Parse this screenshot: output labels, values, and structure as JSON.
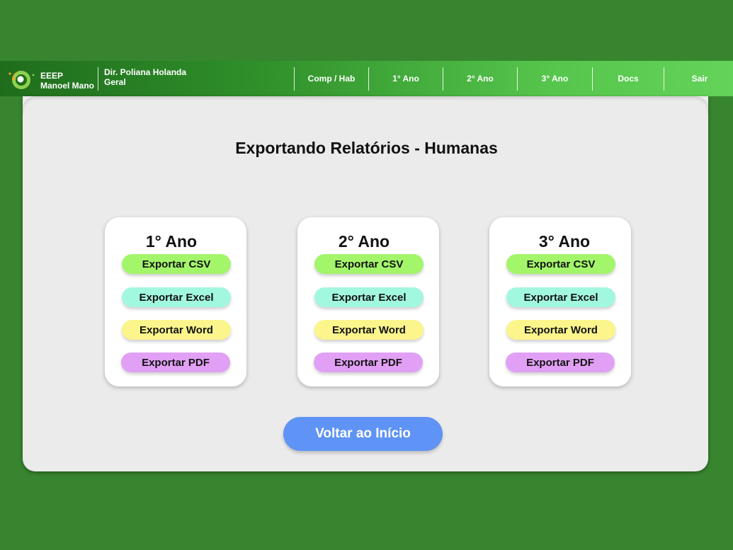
{
  "header": {
    "school_name": "EEEP Manoel Mano",
    "director": "Dir. Poliana Holanda Geral",
    "nav": [
      "Comp / Hab",
      "1° Ano",
      "2° Ano",
      "3° Ano",
      "Docs",
      "Sair"
    ]
  },
  "main": {
    "title": "Exportando Relatórios - Humanas",
    "years": [
      {
        "title": "1° Ano",
        "buttons": [
          "Exportar CSV",
          "Exportar Excel",
          "Exportar Word",
          "Exportar PDF"
        ]
      },
      {
        "title": "2° Ano",
        "buttons": [
          "Exportar CSV",
          "Exportar Excel",
          "Exportar Word",
          "Exportar PDF"
        ]
      },
      {
        "title": "3° Ano",
        "buttons": [
          "Exportar CSV",
          "Exportar Excel",
          "Exportar Word",
          "Exportar PDF"
        ]
      }
    ],
    "back_button": "Voltar ao Início"
  },
  "colors": {
    "page_bg": "#388530",
    "csv": "#a3f56a",
    "excel": "#a2f7df",
    "word": "#fbf58c",
    "pdf": "#e1a0f5",
    "back": "#5f93f5"
  }
}
